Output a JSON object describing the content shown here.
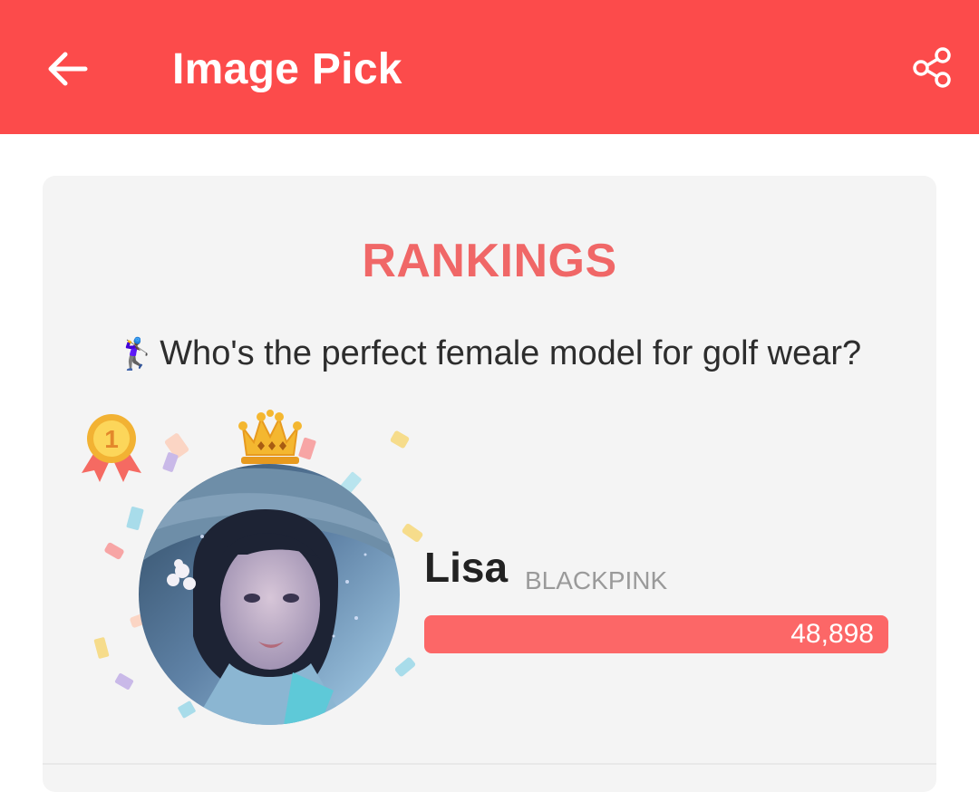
{
  "appbar": {
    "title": "Image Pick",
    "back_icon": "arrow-left-icon",
    "share_icon": "share-icon",
    "color": "#fc4b4b"
  },
  "rankings": {
    "heading": "RANKINGS",
    "question_emoji": "🏌️‍♀️",
    "question": "Who's the perfect female model for golf wear?",
    "accent_color": "#f06767"
  },
  "winner": {
    "rank": "1",
    "name": "Lisa",
    "group": "BLACKPINK",
    "votes": "48,898",
    "vote_fraction": 1.0,
    "medal_icon": "gold-medal-icon",
    "crown_icon": "crown-icon"
  }
}
